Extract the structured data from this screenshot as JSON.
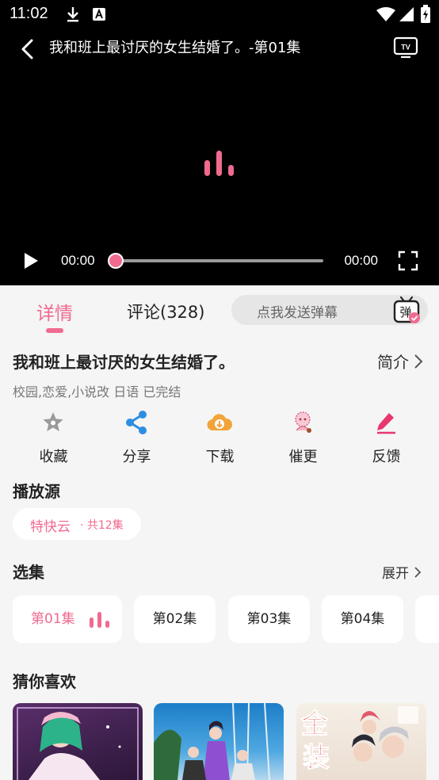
{
  "status_bar": {
    "time": "11:02",
    "icons": [
      "download-icon",
      "text-a-icon",
      "wifi-icon",
      "signal-icon",
      "battery-charging-icon"
    ]
  },
  "player": {
    "title": "我和班上最讨厌的女生结婚了。-第01集",
    "current_time": "00:00",
    "total_time": "00:00",
    "progress": 0,
    "icons": [
      "back-icon",
      "tv-cast-icon",
      "loading-bars-icon",
      "play-icon",
      "fullscreen-icon"
    ]
  },
  "tabs": {
    "detail": "详情",
    "comments": "评论(328)",
    "danmaku_placeholder": "点我发送弹幕",
    "danmaku_icon_char": "弹"
  },
  "info": {
    "title": "我和班上最讨厌的女生结婚了。",
    "intro_link": "简介",
    "tags": "校园,恋爱,小说改 日语 已完结"
  },
  "actions": [
    {
      "label": "收藏",
      "icon": "star-icon"
    },
    {
      "label": "分享",
      "icon": "share-icon"
    },
    {
      "label": "下载",
      "icon": "cloud-download-icon"
    },
    {
      "label": "催更",
      "icon": "mascot-icon"
    },
    {
      "label": "反馈",
      "icon": "edit-pen-icon"
    }
  ],
  "source": {
    "section_title": "播放源",
    "name": "特快云",
    "count": "· 共12集"
  },
  "episodes": {
    "section_title": "选集",
    "expand_link": "展开",
    "items": [
      "第01集",
      "第02集",
      "第03集",
      "第04集"
    ],
    "active_index": 0
  },
  "recommend": {
    "section_title": "猜你喜欢"
  },
  "colors": {
    "accent": "#f06a8f",
    "share_blue": "#2d8ee0",
    "download_orange": "#f2a33a",
    "edit_pink": "#e8366e",
    "star_gray": "#9a9a9a"
  }
}
